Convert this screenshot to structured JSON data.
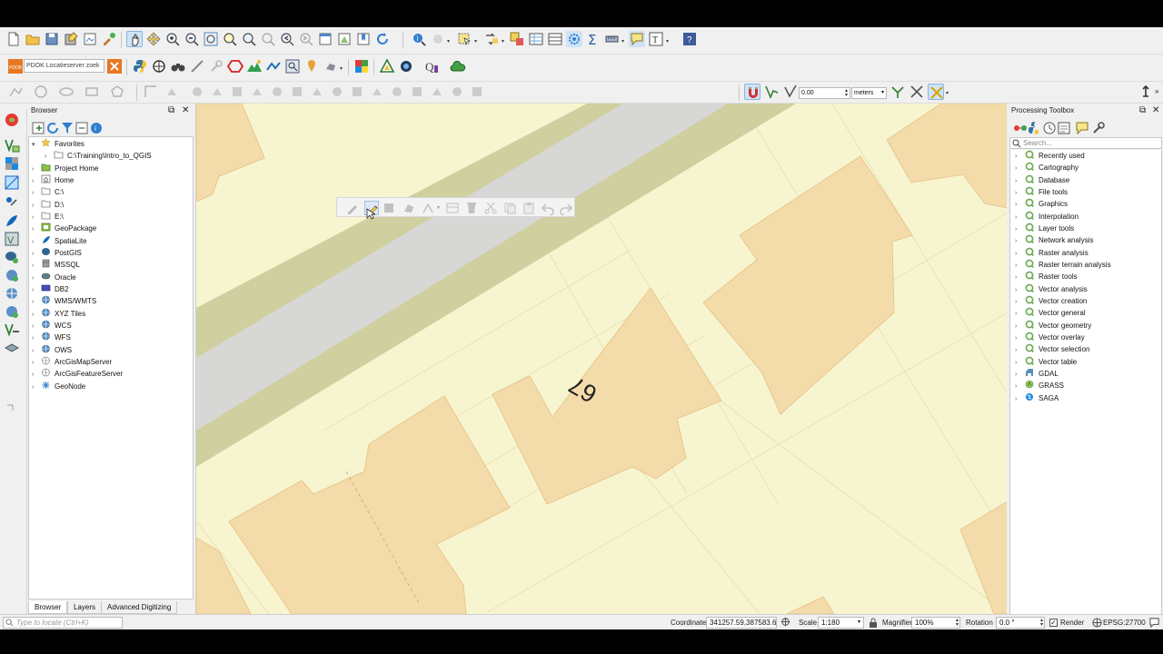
{
  "toolbars": {
    "locator_plugin": {
      "value": "PDOK Locatieserver zoek"
    },
    "snapping": {
      "tolerance": "0.00",
      "units": "meters"
    }
  },
  "browser": {
    "title": "Browser",
    "items": [
      {
        "label": "Favorites",
        "icon": "star-icon",
        "level": 0
      },
      {
        "label": "C:\\Training\\Intro_to_QGIS",
        "icon": "folder-icon",
        "level": 1
      },
      {
        "label": "Project Home",
        "icon": "project-home-icon",
        "level": 0
      },
      {
        "label": "Home",
        "icon": "home-icon",
        "level": 0
      },
      {
        "label": "C:\\",
        "icon": "folder-icon",
        "level": 0
      },
      {
        "label": "D:\\",
        "icon": "folder-icon",
        "level": 0
      },
      {
        "label": "E:\\",
        "icon": "folder-icon",
        "level": 0
      },
      {
        "label": "GeoPackage",
        "icon": "geopackage-icon",
        "level": 0
      },
      {
        "label": "SpatiaLite",
        "icon": "spatialite-icon",
        "level": 0
      },
      {
        "label": "PostGIS",
        "icon": "postgis-icon",
        "level": 0
      },
      {
        "label": "MSSQL",
        "icon": "mssql-icon",
        "level": 0
      },
      {
        "label": "Oracle",
        "icon": "oracle-icon",
        "level": 0
      },
      {
        "label": "DB2",
        "icon": "db2-icon",
        "level": 0
      },
      {
        "label": "WMS/WMTS",
        "icon": "globe-icon",
        "level": 0
      },
      {
        "label": "XYZ Tiles",
        "icon": "globe-icon",
        "level": 0
      },
      {
        "label": "WCS",
        "icon": "globe-icon",
        "level": 0
      },
      {
        "label": "WFS",
        "icon": "globe-icon",
        "level": 0
      },
      {
        "label": "OWS",
        "icon": "globe-icon",
        "level": 0
      },
      {
        "label": "ArcGisMapServer",
        "icon": "arcgis-icon",
        "level": 0
      },
      {
        "label": "ArcGisFeatureServer",
        "icon": "arcgis-icon",
        "level": 0
      },
      {
        "label": "GeoNode",
        "icon": "geonode-icon",
        "level": 0
      }
    ],
    "tabs": [
      "Browser",
      "Layers",
      "Advanced Digitizing"
    ]
  },
  "map": {
    "house_number": "67",
    "colors": {
      "background": "#f7f5cf",
      "building": "#f4dcaa",
      "road": "#d7d7d5",
      "verge": "#cfcf9f"
    }
  },
  "toolbox": {
    "title": "Processing Toolbox",
    "search_placeholder": "Search...",
    "items": [
      {
        "label": "Recently used",
        "icon": "processing-q-icon"
      },
      {
        "label": "Cartography",
        "icon": "processing-q-icon"
      },
      {
        "label": "Database",
        "icon": "processing-q-icon"
      },
      {
        "label": "File tools",
        "icon": "processing-q-icon"
      },
      {
        "label": "Graphics",
        "icon": "processing-q-icon"
      },
      {
        "label": "Interpolation",
        "icon": "processing-q-icon"
      },
      {
        "label": "Layer tools",
        "icon": "processing-q-icon"
      },
      {
        "label": "Network analysis",
        "icon": "processing-q-icon"
      },
      {
        "label": "Raster analysis",
        "icon": "processing-q-icon"
      },
      {
        "label": "Raster terrain analysis",
        "icon": "processing-q-icon"
      },
      {
        "label": "Raster tools",
        "icon": "processing-q-icon"
      },
      {
        "label": "Vector analysis",
        "icon": "processing-q-icon"
      },
      {
        "label": "Vector creation",
        "icon": "processing-q-icon"
      },
      {
        "label": "Vector general",
        "icon": "processing-q-icon"
      },
      {
        "label": "Vector geometry",
        "icon": "processing-q-icon"
      },
      {
        "label": "Vector overlay",
        "icon": "processing-q-icon"
      },
      {
        "label": "Vector selection",
        "icon": "processing-q-icon"
      },
      {
        "label": "Vector table",
        "icon": "processing-q-icon"
      },
      {
        "label": "GDAL",
        "icon": "gdal-icon"
      },
      {
        "label": "GRASS",
        "icon": "grass-icon"
      },
      {
        "label": "SAGA",
        "icon": "saga-icon"
      }
    ]
  },
  "statusbar": {
    "locator_placeholder": "Type to locate (Ctrl+K)",
    "coordinate_label": "Coordinate",
    "coordinate_value": "341257.59,387583.64",
    "scale_label": "Scale",
    "scale_value": "1:180",
    "magnifier_label": "Magnifier",
    "magnifier_value": "100%",
    "rotation_label": "Rotation",
    "rotation_value": "0.0 °",
    "render_label": "Render",
    "crs": "EPSG:27700"
  }
}
